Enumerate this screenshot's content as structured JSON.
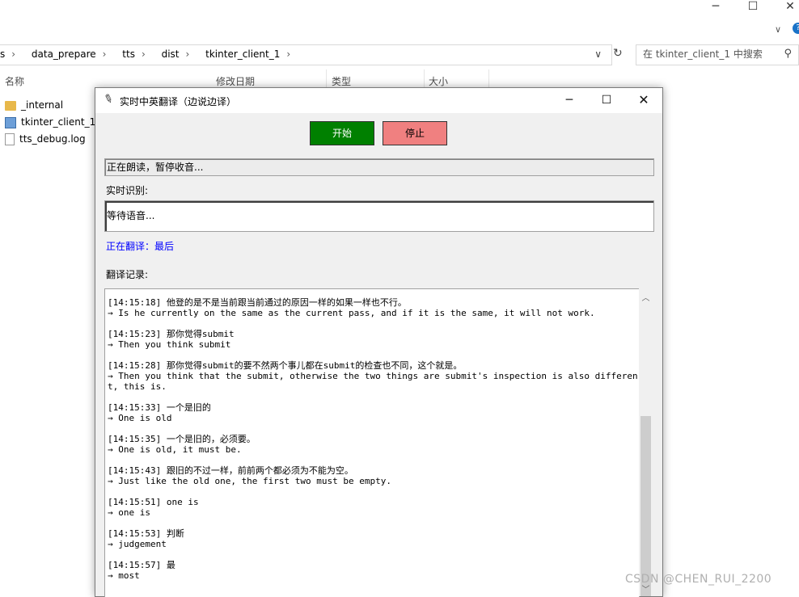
{
  "explorer": {
    "window_controls": {
      "minimize": "─",
      "maximize": "☐",
      "close": "✕"
    },
    "help_badge": "?",
    "breadcrumb": [
      "s",
      "data_prepare",
      "tts",
      "dist",
      "tkinter_client_1"
    ],
    "search_placeholder": "在 tkinter_client_1 中搜索",
    "columns": {
      "name": "名称",
      "date": "修改日期",
      "type": "类型",
      "size": "大小"
    },
    "files": [
      {
        "name": "_internal",
        "icon": "folder-icon"
      },
      {
        "name": "tkinter_client_1.e",
        "icon": "exe-icon"
      },
      {
        "name": "tts_debug.log",
        "icon": "document-icon"
      }
    ]
  },
  "app": {
    "title": "实时中英翻译（边说边译）",
    "start_label": "开始",
    "stop_label": "停止",
    "status_text": "正在朗读，暂停收音...",
    "realtime_label": "实时识别:",
    "realtime_text": "等待语音...",
    "translating_text": "正在翻译：最后",
    "history_label": "翻译记录:",
    "colors": {
      "start": "#008000",
      "stop": "#f08080",
      "translating": "#0000ff"
    },
    "log": [
      {
        "zh": "[14:15:18] 他登的是不是当前跟当前通过的原因一样的如果一样也不行。",
        "en": "→ Is he currently on the same as the current pass, and if it is the same, it will not work."
      },
      {
        "zh": "[14:15:23] 那你觉得submit",
        "en": "→ Then you think submit"
      },
      {
        "zh": "[14:15:28] 那你觉得submit的要不然两个事儿都在submit的检查也不同，这个就是。",
        "en": "→ Then you think that the submit, otherwise the two things are submit's inspection is also different, this is."
      },
      {
        "zh": "[14:15:33] 一个是旧的",
        "en": "→ One is old"
      },
      {
        "zh": "[14:15:35] 一个是旧的，必须要。",
        "en": "→ One is old, it must be."
      },
      {
        "zh": "[14:15:43] 跟旧的不过一样，前前两个都必须为不能为空。",
        "en": "→ Just like the old one, the first two must be empty."
      },
      {
        "zh": "[14:15:51] one is",
        "en": "→ one is"
      },
      {
        "zh": "[14:15:53] 判断",
        "en": "→ judgement"
      },
      {
        "zh": "[14:15:57] 最",
        "en": "→ most"
      }
    ]
  },
  "watermark": "CSDN @CHEN_RUI_2200"
}
